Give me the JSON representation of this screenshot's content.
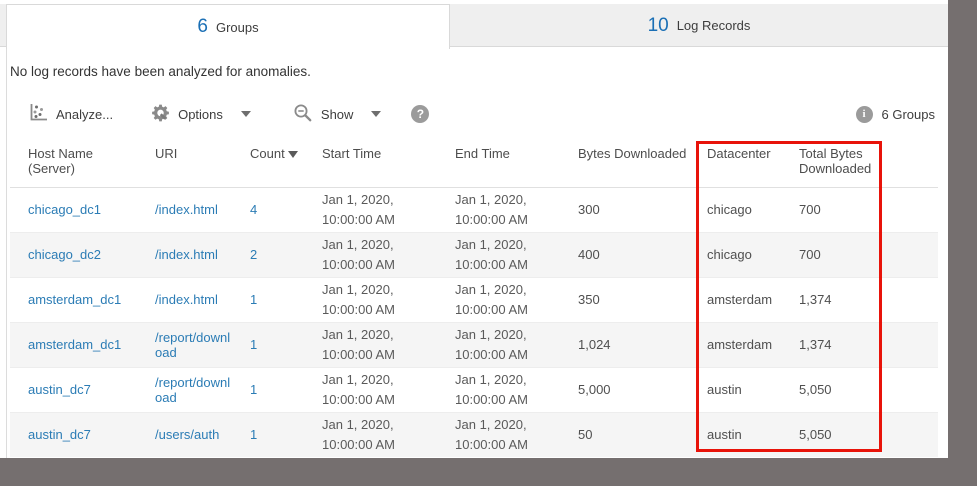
{
  "colors": {
    "accent_blue": "#1a6fb5",
    "link_blue": "#2b7cb5",
    "highlight_red": "#e8130a",
    "desktop_gray": "#756f6f",
    "tabbar_gray": "#efefef",
    "row_stripe": "#f5f5f5"
  },
  "tabs": {
    "groups": {
      "count": "6",
      "label": "Groups"
    },
    "log_records": {
      "count": "10",
      "label": "Log Records"
    }
  },
  "message": "No log records have been analyzed for anomalies.",
  "toolbar": {
    "analyze": "Analyze...",
    "options": "Options",
    "show": "Show",
    "help": "?",
    "info": "i",
    "summary": "6 Groups"
  },
  "table": {
    "headers": [
      "Host Name (Server)",
      "URI",
      "Count",
      "Start Time",
      "End Time",
      "Bytes Downloaded",
      "Datacenter",
      "Total Bytes Downloaded"
    ],
    "rows": [
      {
        "host": "chicago_dc1",
        "uri": "/index.html",
        "count": "4",
        "start": "Jan 1, 2020, 10:00:00 AM",
        "end": "Jan 1, 2020, 10:00:00 AM",
        "bytes": "300",
        "datacenter": "chicago",
        "total": "700"
      },
      {
        "host": "chicago_dc2",
        "uri": "/index.html",
        "count": "2",
        "start": "Jan 1, 2020, 10:00:00 AM",
        "end": "Jan 1, 2020, 10:00:00 AM",
        "bytes": "400",
        "datacenter": "chicago",
        "total": "700"
      },
      {
        "host": "amsterdam_dc1",
        "uri": "/index.html",
        "count": "1",
        "start": "Jan 1, 2020, 10:00:00 AM",
        "end": "Jan 1, 2020, 10:00:00 AM",
        "bytes": "350",
        "datacenter": "amsterdam",
        "total": "1,374"
      },
      {
        "host": "amsterdam_dc1",
        "uri": "/report/download",
        "count": "1",
        "start": "Jan 1, 2020, 10:00:00 AM",
        "end": "Jan 1, 2020, 10:00:00 AM",
        "bytes": "1,024",
        "datacenter": "amsterdam",
        "total": "1,374"
      },
      {
        "host": "austin_dc7",
        "uri": "/report/download",
        "count": "1",
        "start": "Jan 1, 2020, 10:00:00 AM",
        "end": "Jan 1, 2020, 10:00:00 AM",
        "bytes": "5,000",
        "datacenter": "austin",
        "total": "5,050"
      },
      {
        "host": "austin_dc7",
        "uri": "/users/auth",
        "count": "1",
        "start": "Jan 1, 2020, 10:00:00 AM",
        "end": "Jan 1, 2020, 10:00:00 AM",
        "bytes": "50",
        "datacenter": "austin",
        "total": "5,050"
      }
    ]
  }
}
